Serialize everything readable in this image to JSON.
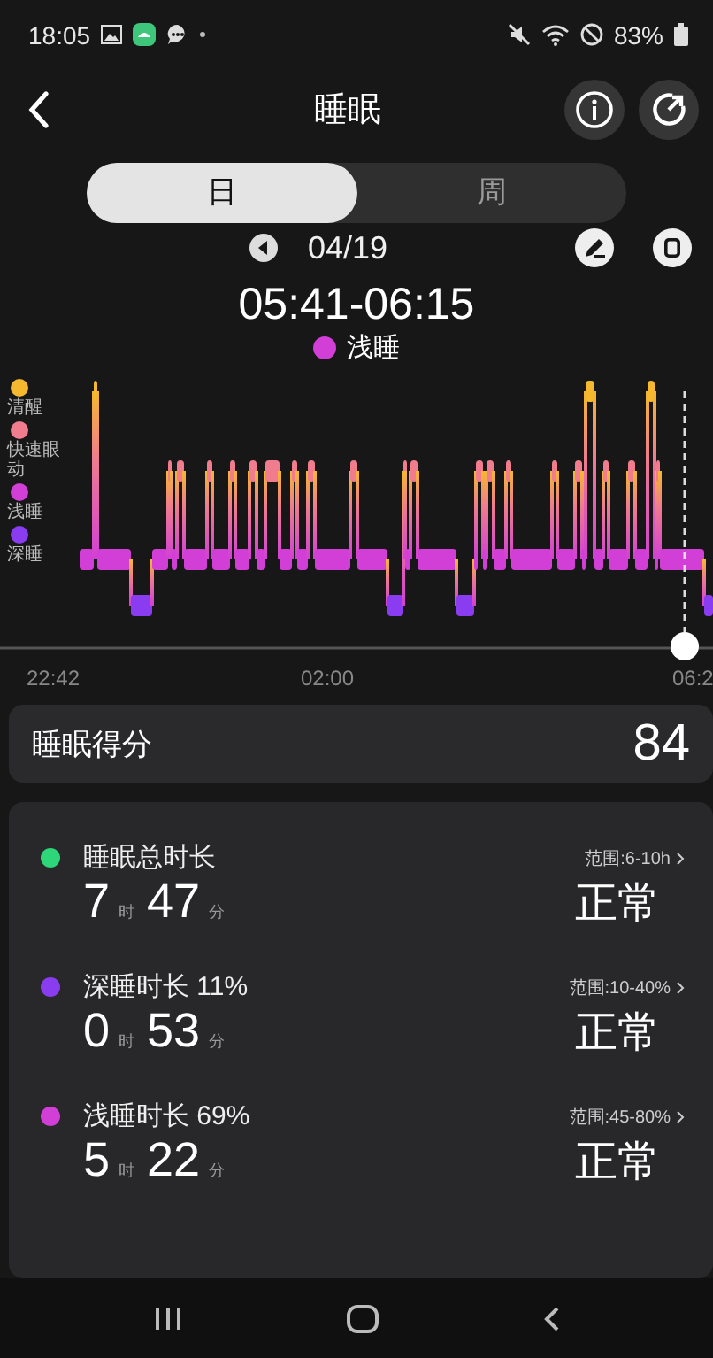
{
  "status_bar": {
    "time": "18:05",
    "battery": "83%"
  },
  "header": {
    "title": "睡眠"
  },
  "period_tabs": [
    {
      "label": "日",
      "selected": true
    },
    {
      "label": "周",
      "selected": false
    }
  ],
  "date": "04/19",
  "selection": {
    "time_range": "05:41-06:15",
    "stage": "浅睡",
    "color": "#d23fd6"
  },
  "legend": [
    {
      "label": "清醒",
      "color": "#f5b82e"
    },
    {
      "label": "快速眼动",
      "color": "#f07c8e"
    },
    {
      "label": "浅睡",
      "color": "#d23fd6"
    },
    {
      "label": "深睡",
      "color": "#8a3cf0"
    }
  ],
  "time_axis": [
    "22:42",
    "02:00",
    "06:2"
  ],
  "score": {
    "label": "睡眠得分",
    "value": "84"
  },
  "metrics": [
    {
      "title": "睡眠总时长",
      "color": "#2ed67a",
      "hours": "7",
      "hour_unit": "时",
      "minutes": "47",
      "minute_unit": "分",
      "range": "范围:6-10h",
      "status": "正常"
    },
    {
      "title": "深睡时长 11%",
      "color": "#8a3cf0",
      "hours": "0",
      "hour_unit": "时",
      "minutes": "53",
      "minute_unit": "分",
      "range": "范围:10-40%",
      "status": "正常"
    },
    {
      "title": "浅睡时长 69%",
      "color": "#d23fd6",
      "hours": "5",
      "hour_unit": "时",
      "minutes": "22",
      "minute_unit": "分",
      "range": "范围:45-80%",
      "status": "正常"
    }
  ]
}
